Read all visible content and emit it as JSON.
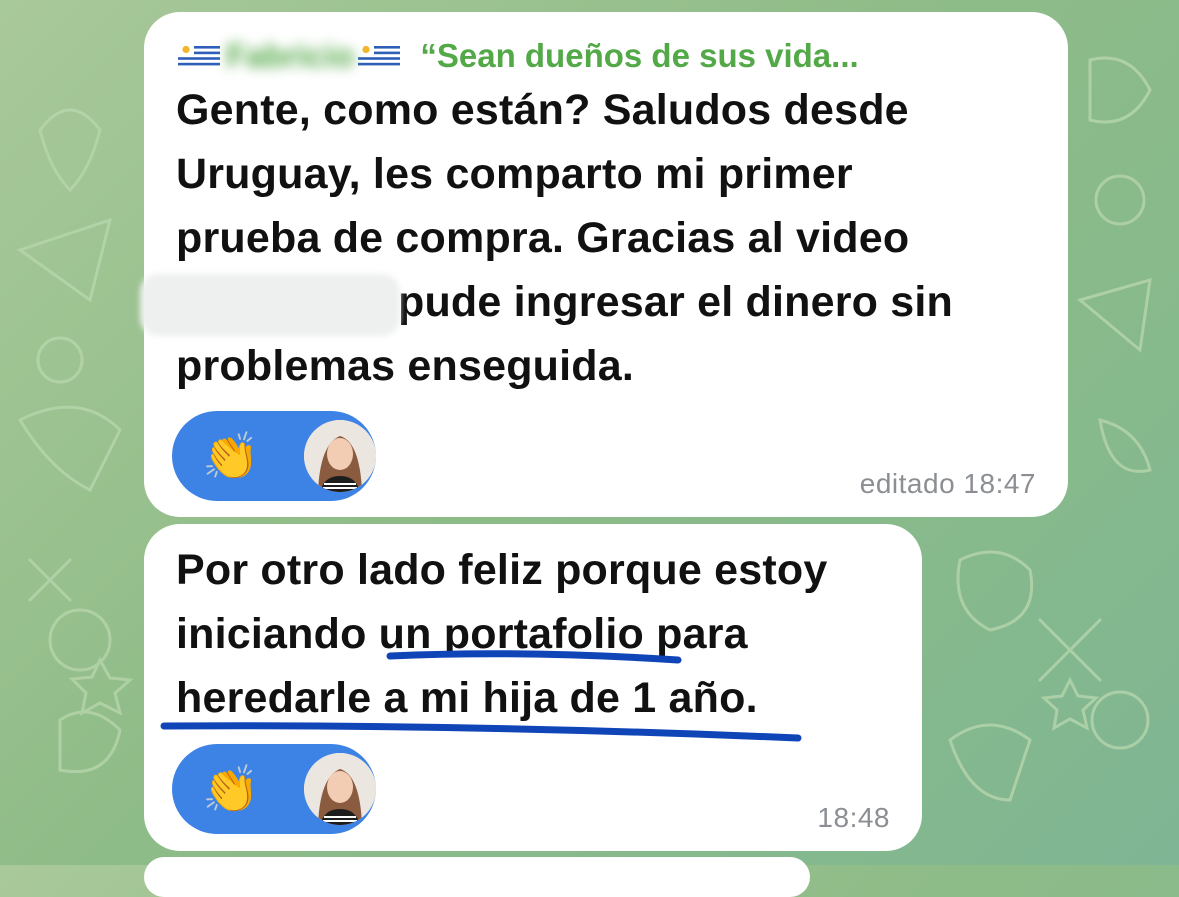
{
  "background": {
    "colors": [
      "#a9c99a",
      "#7fb594"
    ]
  },
  "message1": {
    "sender_flag_left": "uruguay-flag",
    "sender_name": "Fabricio",
    "sender_flag_right": "uruguay-flag",
    "reply_quote": "“Sean dueños de sus vida...",
    "text_lines": [
      "Gente, como están? Saludos desde",
      "Uruguay, les comparto mi primer",
      "prueba de compra. Gracias al video",
      "pude ingresar el dinero sin",
      "problemas enseguida."
    ],
    "reaction_emoji": "👏",
    "timestamp": "editado 18:47"
  },
  "message2": {
    "text_lines": [
      "Por otro lado feliz porque estoy",
      "iniciando un portafolio para",
      "heredarle a mi hija de 1 año."
    ],
    "reaction_emoji": "👏",
    "timestamp": "18:48"
  },
  "colors": {
    "sender": "#53a848",
    "reaction_bg": "#3d83e6",
    "underline": "#1045b8",
    "timestamp": "#8b8f93"
  }
}
